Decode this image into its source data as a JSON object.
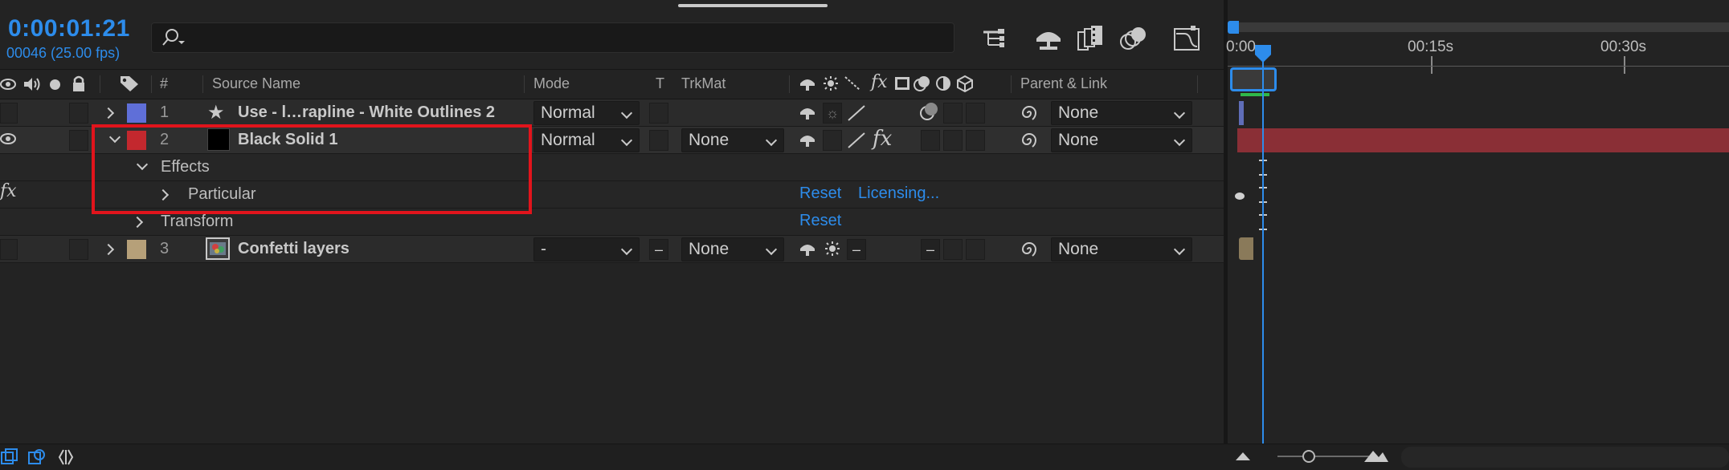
{
  "comp": {
    "timecode": "0:00:01:21",
    "frame_info": "00046 (25.00 fps)"
  },
  "search": {
    "placeholder": ""
  },
  "toolbar_icons": [
    "composition-flowchart-icon",
    "draft-3d-icon",
    "frame-blending-icon",
    "motion-blur-icon",
    "graph-editor-icon"
  ],
  "columns": {
    "hash": "#",
    "source_name": "Source Name",
    "mode": "Mode",
    "t": "T",
    "trkmat": "TrkMat",
    "parent": "Parent & Link"
  },
  "layers": [
    {
      "index": "1",
      "name": "Use - l…rapline - White Outlines 2",
      "label_color": "#5f6fd8",
      "type_icon": "star-icon",
      "mode": "Normal",
      "trkmat": "",
      "parent": "None"
    },
    {
      "index": "2",
      "name": "Black Solid 1",
      "label_color": "#c3282e",
      "type_icon": "solid-swatch-icon",
      "mode": "Normal",
      "trkmat": "None",
      "parent": "None",
      "effects_label": "Effects",
      "effect_name": "Particular",
      "effect_fx": "fx",
      "effect_reset": "Reset",
      "effect_licensing": "Licensing...",
      "transform_label": "Transform",
      "transform_reset": "Reset"
    },
    {
      "index": "3",
      "name": "Confetti layers",
      "label_color": "#b6a079",
      "type_icon": "composition-icon",
      "mode": "-",
      "trkmat": "None",
      "parent": "None",
      "t_value": "–",
      "sw_dash": "–"
    }
  ],
  "timeline": {
    "ruler_labels": [
      "0:00",
      "00:15s",
      "00:30s"
    ]
  }
}
